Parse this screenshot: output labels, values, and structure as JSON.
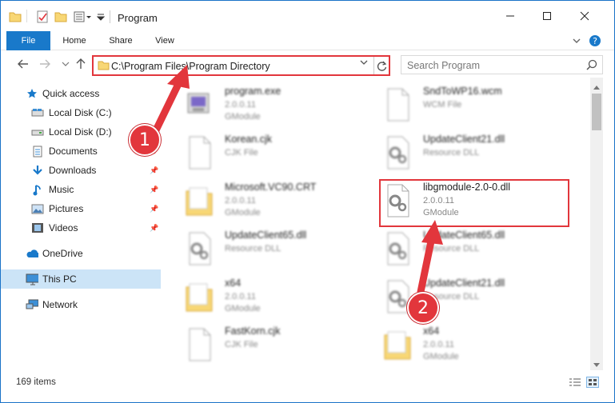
{
  "window": {
    "title": "Program",
    "minimize_icon": "minimize-icon",
    "maximize_icon": "maximize-icon",
    "close_icon": "close-icon"
  },
  "ribbon": {
    "tabs": [
      {
        "label": "File",
        "active": true
      },
      {
        "label": "Home"
      },
      {
        "label": "Share"
      },
      {
        "label": "View"
      }
    ]
  },
  "address": {
    "path": "C:\\Program Files\\Program Directory",
    "search_placeholder": "Search Program"
  },
  "sidebar": {
    "items": [
      {
        "label": "Quick access",
        "icon": "star-icon"
      },
      {
        "label": "Local Disk (C:)",
        "icon": "drive-icon"
      },
      {
        "label": "Local Disk (D:)",
        "icon": "drive-icon"
      },
      {
        "label": "Documents",
        "icon": "documents-icon",
        "pinned": true
      },
      {
        "label": "Downloads",
        "icon": "downloads-icon",
        "pinned": true
      },
      {
        "label": "Music",
        "icon": "music-icon",
        "pinned": true
      },
      {
        "label": "Pictures",
        "icon": "pictures-icon",
        "pinned": true
      },
      {
        "label": "Videos",
        "icon": "videos-icon",
        "pinned": true
      },
      {
        "label": "OneDrive",
        "icon": "cloud-icon"
      },
      {
        "label": "This PC",
        "icon": "pc-icon",
        "selected": true
      },
      {
        "label": "Network",
        "icon": "network-icon"
      }
    ]
  },
  "files": [
    {
      "name": "program.exe",
      "line1": "2.0.0.11",
      "line2": "GModule",
      "icon": "exe-icon"
    },
    {
      "name": "SndToWP16.wcm",
      "line1": "WCM File",
      "line2": "",
      "icon": "blank-file-icon"
    },
    {
      "name": "Korean.cjk",
      "line1": "CJK File",
      "line2": "",
      "icon": "blank-file-icon"
    },
    {
      "name": "UpdateClient21.dll",
      "line1": "Resource DLL",
      "line2": "",
      "icon": "dll-icon"
    },
    {
      "name": "Microsoft.VC90.CRT",
      "line1": "2.0.0.11",
      "line2": "GModule",
      "icon": "folder-icon"
    },
    {
      "name": "libgmodule-2.0-0.dll",
      "line1": "2.0.0.11",
      "line2": "GModule",
      "icon": "dll-icon"
    },
    {
      "name": "UpdateClient65.dll",
      "line1": "Resource DLL",
      "line2": "",
      "icon": "dll-icon"
    },
    {
      "name": "UpdateClient65.dll",
      "line1": "Resource DLL",
      "line2": "",
      "icon": "dll-icon"
    },
    {
      "name": "x64",
      "line1": "2.0.0.11",
      "line2": "GModule",
      "icon": "folder-icon"
    },
    {
      "name": "UpdateClient21.dll",
      "line1": "Resource DLL",
      "line2": "",
      "icon": "dll-icon"
    },
    {
      "name": "FastKorn.cjk",
      "line1": "CJK File",
      "line2": "",
      "icon": "blank-file-icon"
    },
    {
      "name": "x64",
      "line1": "2.0.0.11",
      "line2": "GModule",
      "icon": "folder-icon"
    }
  ],
  "status": {
    "item_count": "169 items"
  },
  "callouts": [
    "1",
    "2"
  ],
  "colors": {
    "accent": "#1979ca",
    "highlight": "#e2363c",
    "selected": "#cce4f7"
  }
}
